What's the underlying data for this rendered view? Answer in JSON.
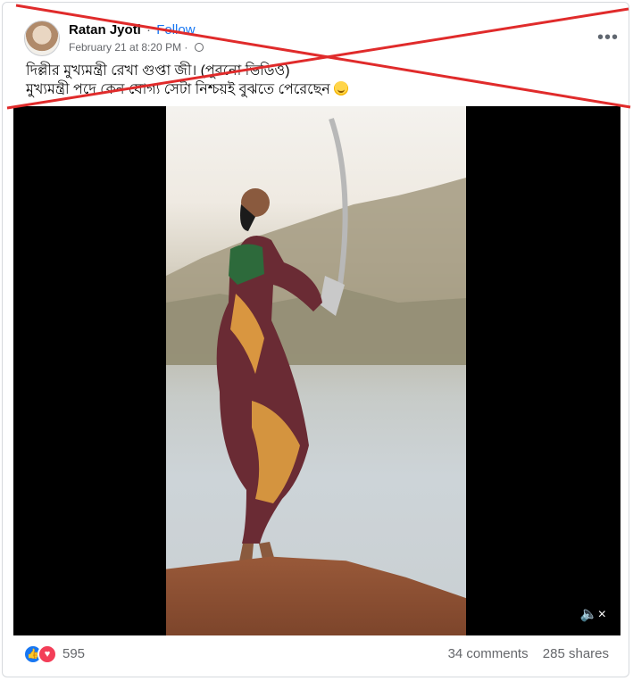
{
  "post": {
    "author": "Ratan Jyoti",
    "separator": "·",
    "follow_label": "Follow",
    "timestamp": "February 21 at 8:20 PM",
    "meta_separator": "·",
    "privacy_icon": "globe-icon",
    "more_icon": "•••",
    "text_line1": "দিল্লীর মুখ্যমন্ত্রী রেখা গুপ্তা জী। (পুরনো ভিডিও)",
    "text_line2": "মুখ্যমন্ত্রী পদে কেন যোগ্য সেটা নিশ্চয়ই বুঝতে পেরেছেন",
    "emoji": "smiling-face-emoji"
  },
  "video": {
    "sound_icon": "speaker-muted-icon",
    "sound_glyph": "🔈×"
  },
  "stats": {
    "like_icon": "👍",
    "love_icon": "♥",
    "reaction_count": "595",
    "comments": "34 comments",
    "shares": "285 shares"
  },
  "overlay": {
    "cross_color": "#e02b2b"
  }
}
